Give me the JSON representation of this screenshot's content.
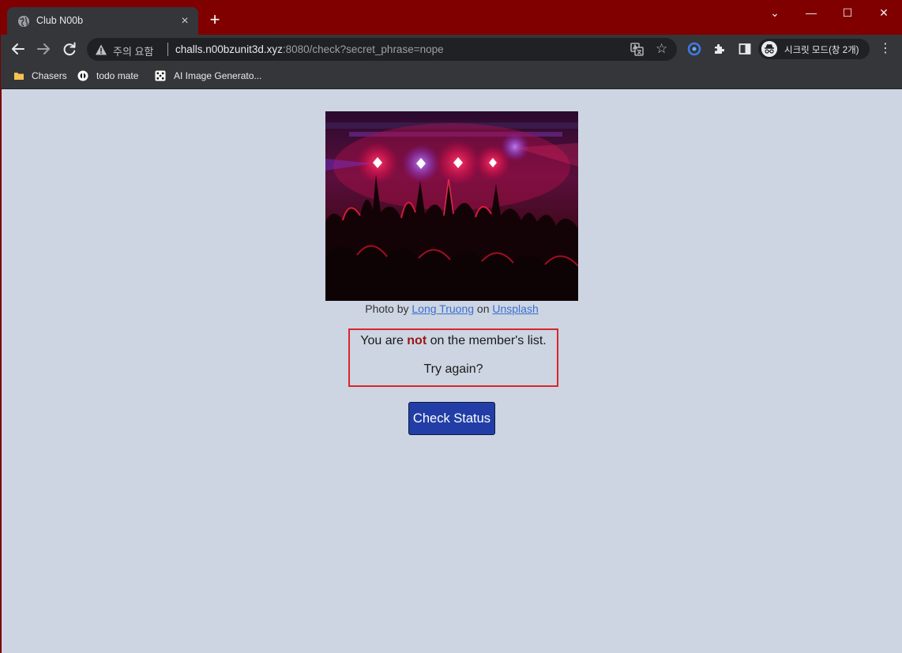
{
  "browser": {
    "tab_title": "Club N00b",
    "tab_close": "×",
    "new_tab": "+",
    "window_controls": {
      "chevron": "⌄",
      "minimize": "—",
      "maximize": "☐",
      "close": "✕"
    },
    "security_label": "주의 요함",
    "url_host": "challs.n00bzunit3d.xyz",
    "url_rest": ":8080/check?secret_phrase=nope",
    "bookmark_star": "☆",
    "profile_label": "시크릿 모드(창 2개)",
    "menu": "⋮",
    "bookmarks": [
      {
        "label": "Chasers",
        "icon": "folder-icon"
      },
      {
        "label": "todo mate",
        "icon": "todo-mate-icon"
      },
      {
        "label": "AI Image Generato...",
        "icon": "dice-icon"
      }
    ],
    "icons": [
      "globe-icon",
      "back-arrow-icon",
      "forward-arrow-icon",
      "reload-icon",
      "warning-icon",
      "translate-icon",
      "star-icon",
      "extension-g-icon",
      "puzzle-icon",
      "side-panel-icon",
      "incognito-icon",
      "kebab-menu-icon"
    ]
  },
  "page": {
    "credit_prefix": "Photo by ",
    "credit_author": "Long Truong",
    "credit_mid": " on ",
    "credit_site": "Unsplash",
    "message_prefix": "You are ",
    "message_emph": "not",
    "message_suffix": " on the member's list.",
    "retry": "Try again?",
    "button_label": "Check Status"
  },
  "colors": {
    "titlebar": "#800000",
    "page_bg": "#ccd5e1",
    "button_bg": "#223ea6",
    "alert_border": "#d9262c",
    "link": "#3b6fd1"
  }
}
